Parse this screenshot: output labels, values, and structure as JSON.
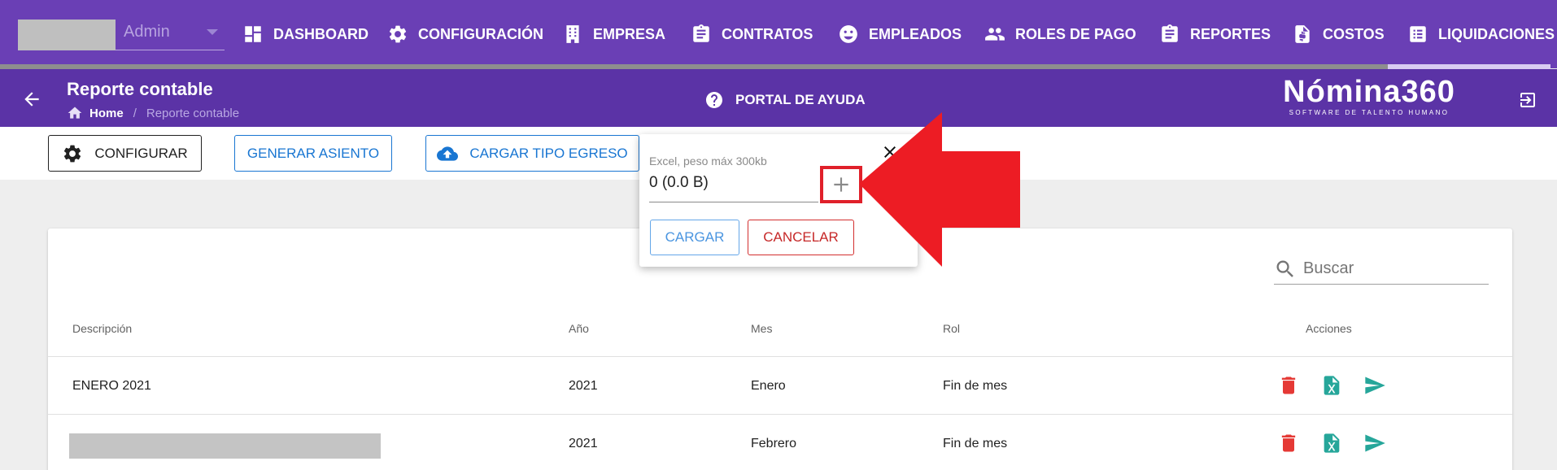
{
  "topnav": {
    "company_select": {
      "value": "Admin"
    },
    "items": [
      {
        "label": "DASHBOARD",
        "icon": "dashboard-icon"
      },
      {
        "label": "CONFIGURACIÓN",
        "icon": "gear-icon"
      },
      {
        "label": "EMPRESA",
        "icon": "building-icon"
      },
      {
        "label": "CONTRATOS",
        "icon": "clipboard-icon"
      },
      {
        "label": "EMPLEADOS",
        "icon": "face-icon"
      },
      {
        "label": "ROLES DE PAGO",
        "icon": "people-icon"
      },
      {
        "label": "REPORTES",
        "icon": "clipboard-icon"
      },
      {
        "label": "COSTOS",
        "icon": "dollar-file-icon"
      },
      {
        "label": "LIQUIDACIONES",
        "icon": "list-icon"
      }
    ],
    "active_item": "LIQUIDACIONES"
  },
  "subheader": {
    "title": "Reporte contable",
    "breadcrumb": {
      "home": "Home",
      "current": "Reporte contable"
    },
    "help_link": "PORTAL DE AYUDA",
    "brand": {
      "name": "Nómina360",
      "tagline": "SOFTWARE DE TALENTO HUMANO"
    }
  },
  "toolbar": {
    "configurar": "CONFIGURAR",
    "generar_asiento": "GENERAR ASIENTO",
    "cargar_tipo_egreso": "CARGAR TIPO EGRESO"
  },
  "upload_popup": {
    "file_hint": "Excel, peso máx 300kb",
    "file_value": "0 (0.0 B)",
    "cargar": "CARGAR",
    "cancelar": "CANCELAR"
  },
  "table": {
    "search_placeholder": "Buscar",
    "columns": [
      "Descripción",
      "Año",
      "Mes",
      "Rol",
      "Acciones"
    ],
    "rows": [
      {
        "descripcion": "ENERO 2021",
        "anio": "2021",
        "mes": "Enero",
        "rol": "Fin de mes"
      },
      {
        "descripcion": "",
        "anio": "2021",
        "mes": "Febrero",
        "rol": "Fin de mes"
      }
    ]
  },
  "colors": {
    "nav_bg": "#6a3fb5",
    "subheader_bg": "#5b33a6",
    "primary_blue": "#1976d2",
    "delete_red": "#e53935",
    "action_teal": "#26a69a",
    "annotation_red": "#ed1c24"
  }
}
